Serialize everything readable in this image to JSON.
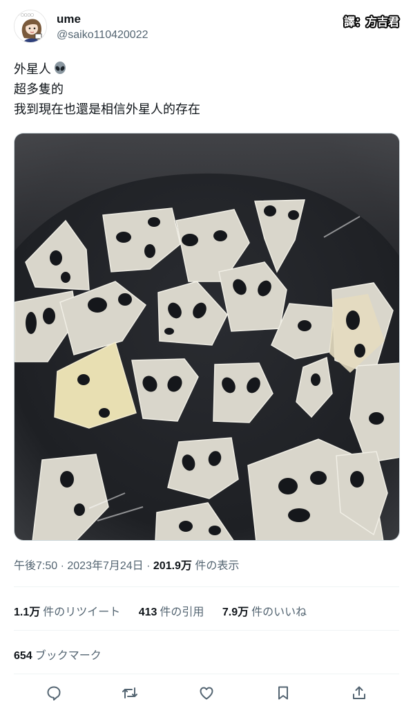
{
  "author": {
    "name": "ume",
    "handle": "@saiko110420022",
    "avatar_icon": "cartoon-avatar-icon"
  },
  "translator_credit": "譯：方吉君",
  "tweet": {
    "lines": [
      "外星人",
      "超多隻的",
      "我到現在也還是相信外星人的存在"
    ],
    "emoji": "alien-icon"
  },
  "photo": {
    "icon": "lotus-root-slices-in-pan-photo"
  },
  "meta": {
    "time": "午後7:50",
    "sep1": " · ",
    "date": "2023年7月24日",
    "sep2": " · ",
    "views_count": "201.9万",
    "views_label": " 件の表示"
  },
  "stats": {
    "retweets_count": "1.1万",
    "retweets_label": "件のリツイート",
    "quotes_count": "413",
    "quotes_label": "件の引用",
    "likes_count": "7.9万",
    "likes_label": "件のいいね"
  },
  "bookmarks": {
    "count": "654",
    "label": "ブックマーク"
  },
  "colors": {
    "text": "#0f1419",
    "secondary": "#536471",
    "divider": "#eff3f4"
  }
}
